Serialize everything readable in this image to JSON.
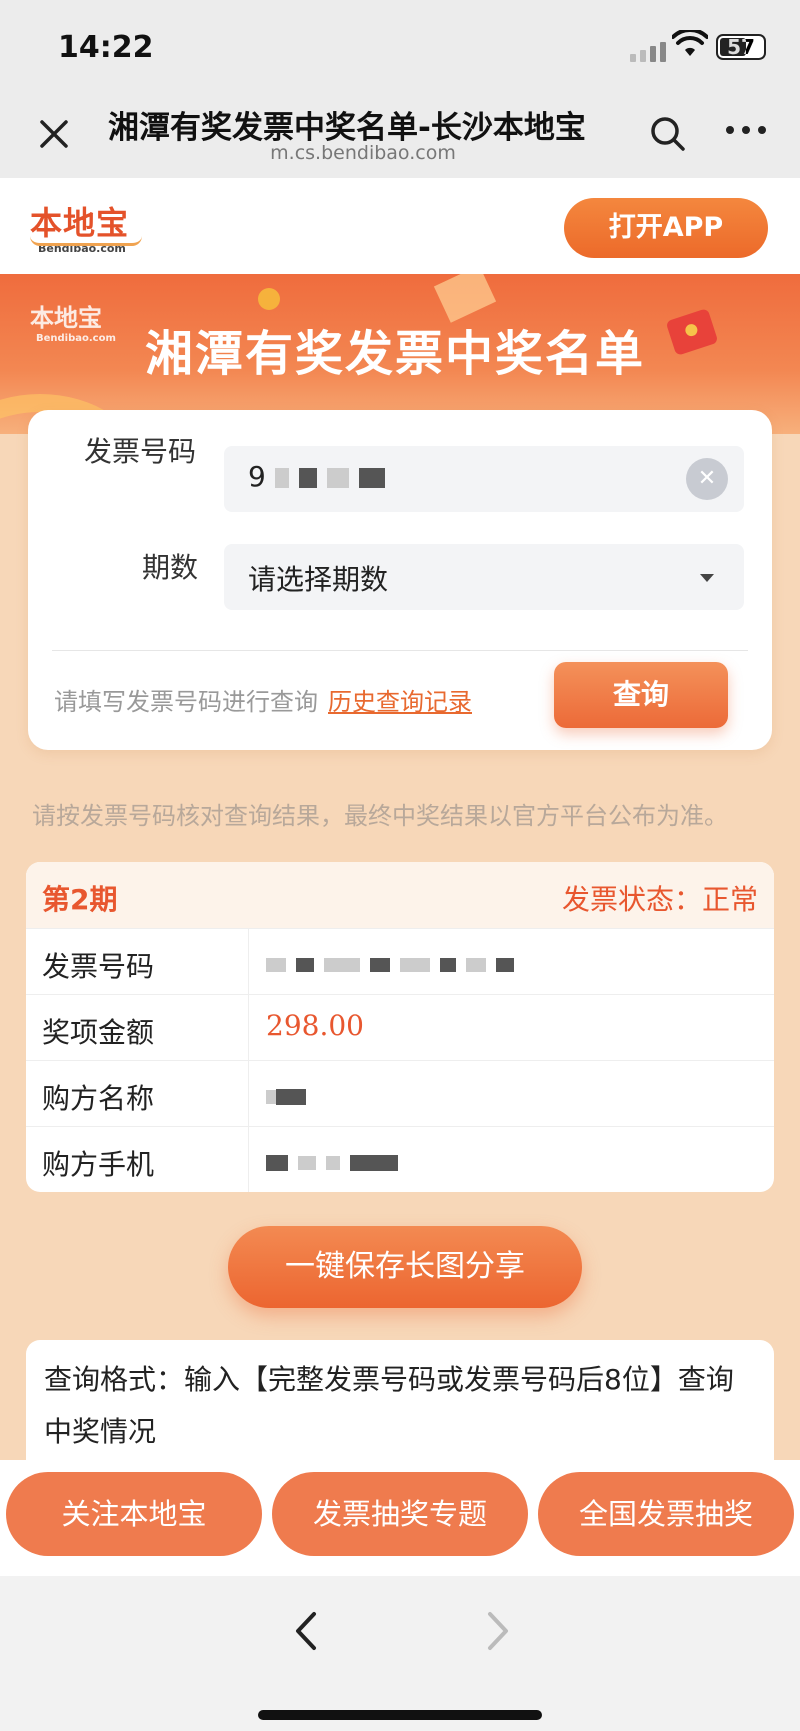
{
  "status_bar": {
    "time": "14:22",
    "battery": "57"
  },
  "nav": {
    "title": "湘潭有奖发票中奖名单-长沙本地宝",
    "url": "m.cs.bendibao.com"
  },
  "site_header": {
    "logo_cn": "本地宝",
    "logo_en": "Bendibao.com",
    "open_app": "打开APP"
  },
  "banner": {
    "logo_cn": "本地宝",
    "logo_en": "Bendibao.com",
    "title": "湘潭有奖发票中奖名单"
  },
  "query_form": {
    "invoice_label": "发票号码",
    "invoice_value_prefix": "9",
    "period_label": "期数",
    "period_placeholder": "请选择期数",
    "hint": "请填写发票号码进行查询",
    "history_link": "历史查询记录",
    "query_button": "查询"
  },
  "notice": "请按发票号码核对查询结果，最终中奖结果以官方平台公布为准。",
  "result": {
    "period": "第2期",
    "status": "发票状态：正常",
    "rows": [
      {
        "label": "发票号码",
        "value": ""
      },
      {
        "label": "奖项金额",
        "value": "298.00"
      },
      {
        "label": "购方名称",
        "value": ""
      },
      {
        "label": "购方手机",
        "value": ""
      }
    ]
  },
  "save_button": "一键保存长图分享",
  "format_text": "查询格式：输入【完整发票号码或发票号码后8位】查询中奖情况",
  "actions": [
    {
      "label": "关注本地宝"
    },
    {
      "label": "发票抽奖专题"
    },
    {
      "label": "全国发票抽奖"
    }
  ],
  "colors": {
    "accent": "#ec6a2a",
    "banner": "#ef6c3d",
    "page_bg": "#f7d7b8"
  }
}
